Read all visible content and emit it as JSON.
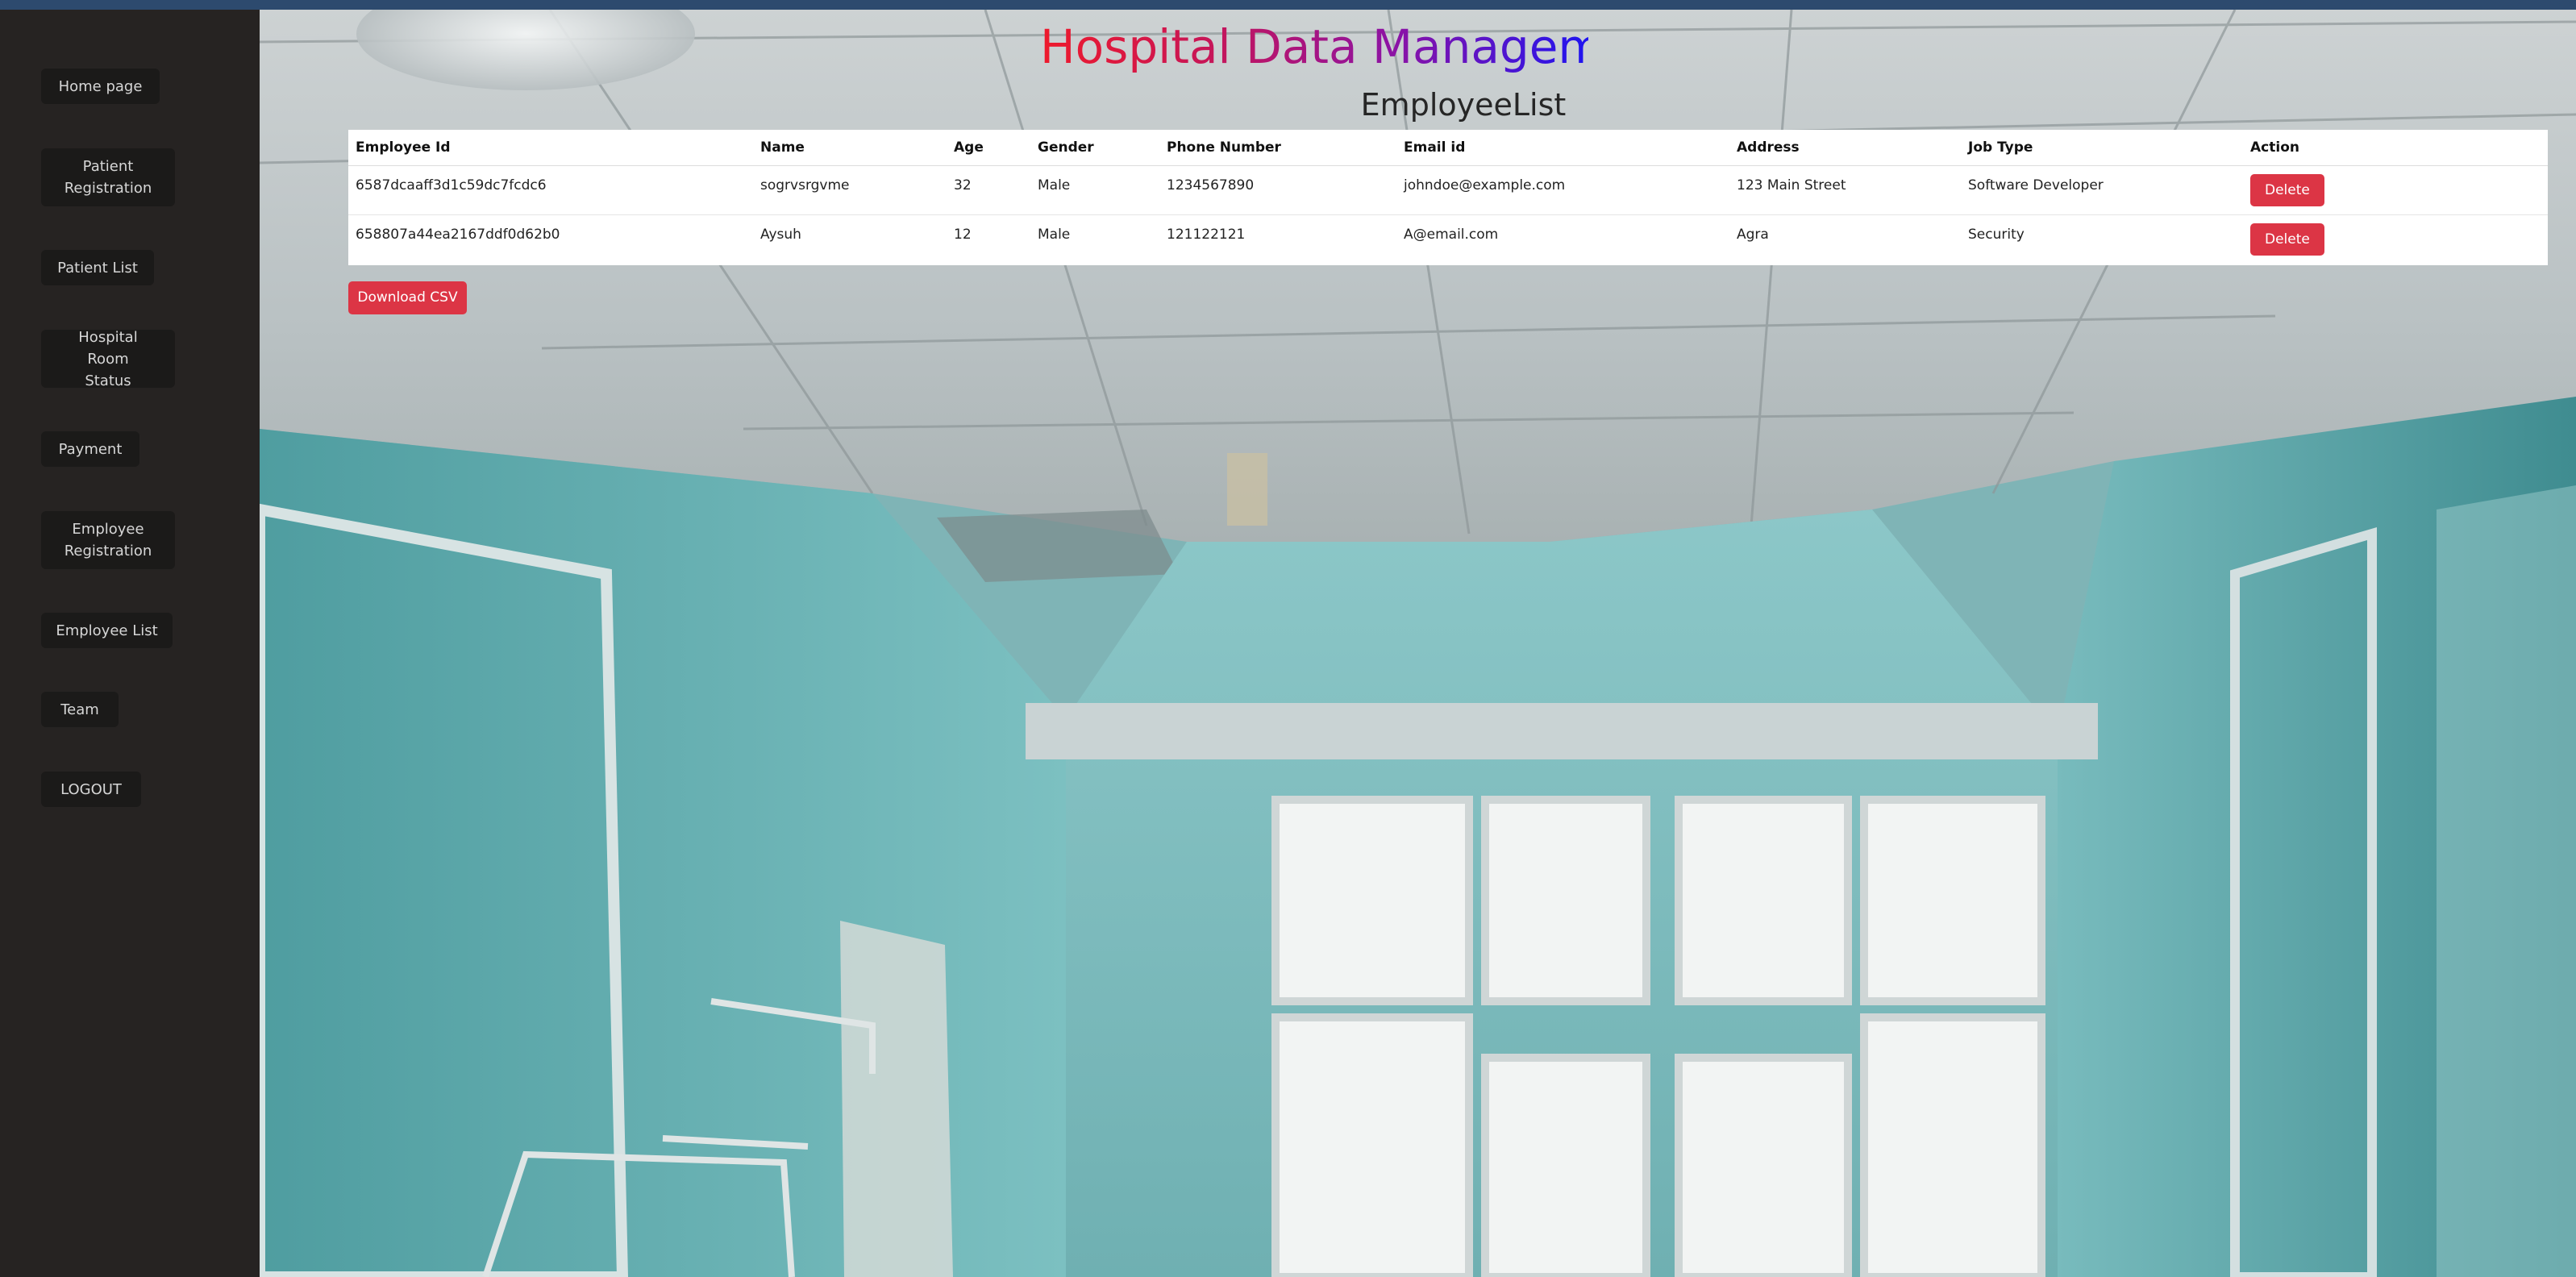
{
  "app": {
    "title": "Hospital Data Management",
    "page_heading": "EmployeeList"
  },
  "sidebar": {
    "items": [
      {
        "label": "Home page"
      },
      {
        "label": "Patient Registration"
      },
      {
        "label": "Patient List"
      },
      {
        "label": "Hospital Room Status"
      },
      {
        "label": "Payment"
      },
      {
        "label": "Employee Registration"
      },
      {
        "label": "Employee List"
      },
      {
        "label": "Team"
      },
      {
        "label": "LOGOUT"
      }
    ]
  },
  "table": {
    "headers": [
      "Employee Id",
      "Name",
      "Age",
      "Gender",
      "Phone Number",
      "Email id",
      "Address",
      "Job Type",
      "Action"
    ],
    "rows": [
      {
        "employee_id": "6587dcaaff3d1c59dc7fcdc6",
        "name": "sogrvsrgvme",
        "age": "32",
        "gender": "Male",
        "phone": "1234567890",
        "email": "johndoe@example.com",
        "address": "123 Main Street",
        "job_type": "Software Developer",
        "action_label": "Delete"
      },
      {
        "employee_id": "658807a44ea2167ddf0d62b0",
        "name": "Aysuh",
        "age": "12",
        "gender": "Male",
        "phone": "121122121",
        "email": "A@email.com",
        "address": "Agra",
        "job_type": "Security",
        "action_label": "Delete"
      }
    ]
  },
  "actions": {
    "download_csv_label": "Download CSV"
  },
  "colors": {
    "sidebar_bg": "#262322",
    "button_danger": "#dc3545",
    "title_gradient_start": "#ee1a2c",
    "title_gradient_end": "#1f14f0",
    "wall_teal": "#6fb3b5"
  }
}
